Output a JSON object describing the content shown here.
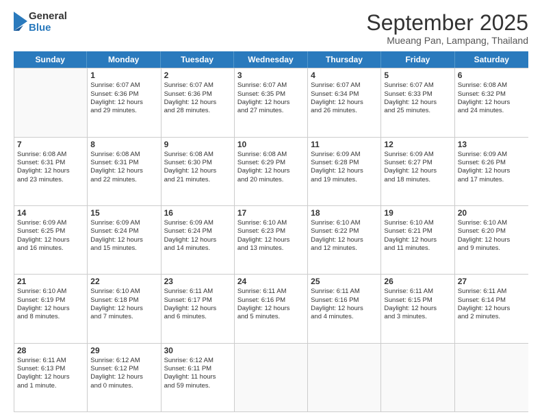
{
  "logo": {
    "general": "General",
    "blue": "Blue"
  },
  "header": {
    "month": "September 2025",
    "location": "Mueang Pan, Lampang, Thailand"
  },
  "weekdays": [
    "Sunday",
    "Monday",
    "Tuesday",
    "Wednesday",
    "Thursday",
    "Friday",
    "Saturday"
  ],
  "rows": [
    [
      {
        "day": "",
        "lines": []
      },
      {
        "day": "1",
        "lines": [
          "Sunrise: 6:07 AM",
          "Sunset: 6:36 PM",
          "Daylight: 12 hours",
          "and 29 minutes."
        ]
      },
      {
        "day": "2",
        "lines": [
          "Sunrise: 6:07 AM",
          "Sunset: 6:36 PM",
          "Daylight: 12 hours",
          "and 28 minutes."
        ]
      },
      {
        "day": "3",
        "lines": [
          "Sunrise: 6:07 AM",
          "Sunset: 6:35 PM",
          "Daylight: 12 hours",
          "and 27 minutes."
        ]
      },
      {
        "day": "4",
        "lines": [
          "Sunrise: 6:07 AM",
          "Sunset: 6:34 PM",
          "Daylight: 12 hours",
          "and 26 minutes."
        ]
      },
      {
        "day": "5",
        "lines": [
          "Sunrise: 6:07 AM",
          "Sunset: 6:33 PM",
          "Daylight: 12 hours",
          "and 25 minutes."
        ]
      },
      {
        "day": "6",
        "lines": [
          "Sunrise: 6:08 AM",
          "Sunset: 6:32 PM",
          "Daylight: 12 hours",
          "and 24 minutes."
        ]
      }
    ],
    [
      {
        "day": "7",
        "lines": [
          "Sunrise: 6:08 AM",
          "Sunset: 6:31 PM",
          "Daylight: 12 hours",
          "and 23 minutes."
        ]
      },
      {
        "day": "8",
        "lines": [
          "Sunrise: 6:08 AM",
          "Sunset: 6:31 PM",
          "Daylight: 12 hours",
          "and 22 minutes."
        ]
      },
      {
        "day": "9",
        "lines": [
          "Sunrise: 6:08 AM",
          "Sunset: 6:30 PM",
          "Daylight: 12 hours",
          "and 21 minutes."
        ]
      },
      {
        "day": "10",
        "lines": [
          "Sunrise: 6:08 AM",
          "Sunset: 6:29 PM",
          "Daylight: 12 hours",
          "and 20 minutes."
        ]
      },
      {
        "day": "11",
        "lines": [
          "Sunrise: 6:09 AM",
          "Sunset: 6:28 PM",
          "Daylight: 12 hours",
          "and 19 minutes."
        ]
      },
      {
        "day": "12",
        "lines": [
          "Sunrise: 6:09 AM",
          "Sunset: 6:27 PM",
          "Daylight: 12 hours",
          "and 18 minutes."
        ]
      },
      {
        "day": "13",
        "lines": [
          "Sunrise: 6:09 AM",
          "Sunset: 6:26 PM",
          "Daylight: 12 hours",
          "and 17 minutes."
        ]
      }
    ],
    [
      {
        "day": "14",
        "lines": [
          "Sunrise: 6:09 AM",
          "Sunset: 6:25 PM",
          "Daylight: 12 hours",
          "and 16 minutes."
        ]
      },
      {
        "day": "15",
        "lines": [
          "Sunrise: 6:09 AM",
          "Sunset: 6:24 PM",
          "Daylight: 12 hours",
          "and 15 minutes."
        ]
      },
      {
        "day": "16",
        "lines": [
          "Sunrise: 6:09 AM",
          "Sunset: 6:24 PM",
          "Daylight: 12 hours",
          "and 14 minutes."
        ]
      },
      {
        "day": "17",
        "lines": [
          "Sunrise: 6:10 AM",
          "Sunset: 6:23 PM",
          "Daylight: 12 hours",
          "and 13 minutes."
        ]
      },
      {
        "day": "18",
        "lines": [
          "Sunrise: 6:10 AM",
          "Sunset: 6:22 PM",
          "Daylight: 12 hours",
          "and 12 minutes."
        ]
      },
      {
        "day": "19",
        "lines": [
          "Sunrise: 6:10 AM",
          "Sunset: 6:21 PM",
          "Daylight: 12 hours",
          "and 11 minutes."
        ]
      },
      {
        "day": "20",
        "lines": [
          "Sunrise: 6:10 AM",
          "Sunset: 6:20 PM",
          "Daylight: 12 hours",
          "and 9 minutes."
        ]
      }
    ],
    [
      {
        "day": "21",
        "lines": [
          "Sunrise: 6:10 AM",
          "Sunset: 6:19 PM",
          "Daylight: 12 hours",
          "and 8 minutes."
        ]
      },
      {
        "day": "22",
        "lines": [
          "Sunrise: 6:10 AM",
          "Sunset: 6:18 PM",
          "Daylight: 12 hours",
          "and 7 minutes."
        ]
      },
      {
        "day": "23",
        "lines": [
          "Sunrise: 6:11 AM",
          "Sunset: 6:17 PM",
          "Daylight: 12 hours",
          "and 6 minutes."
        ]
      },
      {
        "day": "24",
        "lines": [
          "Sunrise: 6:11 AM",
          "Sunset: 6:16 PM",
          "Daylight: 12 hours",
          "and 5 minutes."
        ]
      },
      {
        "day": "25",
        "lines": [
          "Sunrise: 6:11 AM",
          "Sunset: 6:16 PM",
          "Daylight: 12 hours",
          "and 4 minutes."
        ]
      },
      {
        "day": "26",
        "lines": [
          "Sunrise: 6:11 AM",
          "Sunset: 6:15 PM",
          "Daylight: 12 hours",
          "and 3 minutes."
        ]
      },
      {
        "day": "27",
        "lines": [
          "Sunrise: 6:11 AM",
          "Sunset: 6:14 PM",
          "Daylight: 12 hours",
          "and 2 minutes."
        ]
      }
    ],
    [
      {
        "day": "28",
        "lines": [
          "Sunrise: 6:11 AM",
          "Sunset: 6:13 PM",
          "Daylight: 12 hours",
          "and 1 minute."
        ]
      },
      {
        "day": "29",
        "lines": [
          "Sunrise: 6:12 AM",
          "Sunset: 6:12 PM",
          "Daylight: 12 hours",
          "and 0 minutes."
        ]
      },
      {
        "day": "30",
        "lines": [
          "Sunrise: 6:12 AM",
          "Sunset: 6:11 PM",
          "Daylight: 11 hours",
          "and 59 minutes."
        ]
      },
      {
        "day": "",
        "lines": []
      },
      {
        "day": "",
        "lines": []
      },
      {
        "day": "",
        "lines": []
      },
      {
        "day": "",
        "lines": []
      }
    ]
  ]
}
